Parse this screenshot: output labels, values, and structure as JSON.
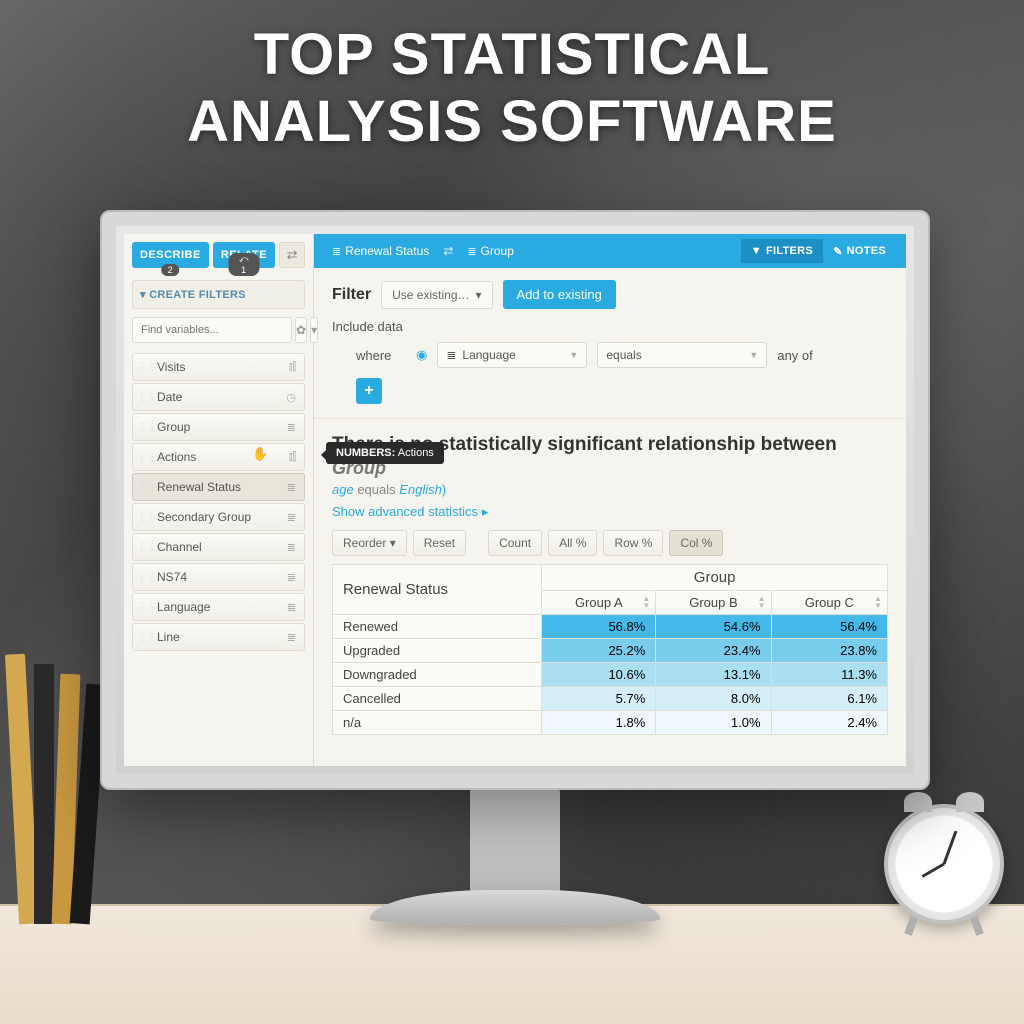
{
  "banner": {
    "line1": "TOP STATISTICAL",
    "line2": "ANALYSIS SOFTWARE"
  },
  "sidebar": {
    "tabs": {
      "describe": "DESCRIBE",
      "describe_badge": "2",
      "relate": "RELATE",
      "relate_badge": "⤺ 1"
    },
    "create_filters": "CREATE FILTERS",
    "search_placeholder": "Find variables...",
    "vars": [
      {
        "name": "Visits",
        "icon": "chart"
      },
      {
        "name": "Date",
        "icon": "clock"
      },
      {
        "name": "Group",
        "icon": "list"
      },
      {
        "name": "Actions",
        "icon": "chart"
      },
      {
        "name": "Renewal Status",
        "icon": "list",
        "selected": true
      },
      {
        "name": "Secondary Group",
        "icon": "list"
      },
      {
        "name": "Channel",
        "icon": "list"
      },
      {
        "name": "NS74",
        "icon": "list"
      },
      {
        "name": "Language",
        "icon": "list"
      },
      {
        "name": "Line",
        "icon": "list"
      }
    ]
  },
  "tooltip": {
    "prefix": "NUMBERS:",
    "value": "Actions"
  },
  "topbar": {
    "crumb1": "Renewal Status",
    "crumb2": "Group",
    "filters": "FILTERS",
    "notes": "NOTES"
  },
  "filter": {
    "title": "Filter",
    "use_existing": "Use existing…",
    "add": "Add to existing",
    "include": "Include data",
    "where": "where",
    "field": "Language",
    "op": "equals",
    "any": "any of"
  },
  "result": {
    "headline": "There is no statistically significant relationship between",
    "group": "Group",
    "cond_var": "age",
    "cond_eq": "equals",
    "cond_val": "English",
    "show_adv": "Show advanced statistics"
  },
  "controls": {
    "reorder": "Reorder",
    "reset": "Reset",
    "count": "Count",
    "all": "All %",
    "row": "Row %",
    "col": "Col %"
  },
  "table": {
    "corner": "Renewal Status",
    "group_label": "Group",
    "cols": [
      "Group A",
      "Group B",
      "Group C"
    ],
    "rows": [
      "Renewed",
      "Upgraded",
      "Downgraded",
      "Cancelled",
      "n/a"
    ]
  },
  "chart_data": {
    "type": "table",
    "title": "Renewal Status by Group (Col %)",
    "row_labels": [
      "Renewed",
      "Upgraded",
      "Downgraded",
      "Cancelled",
      "n/a"
    ],
    "columns": [
      "Group A",
      "Group B",
      "Group C"
    ],
    "unit": "percent",
    "values": [
      [
        56.8,
        54.6,
        56.4
      ],
      [
        25.2,
        23.4,
        23.8
      ],
      [
        10.6,
        13.1,
        11.3
      ],
      [
        5.7,
        8.0,
        6.1
      ],
      [
        1.8,
        1.0,
        2.4
      ]
    ]
  }
}
